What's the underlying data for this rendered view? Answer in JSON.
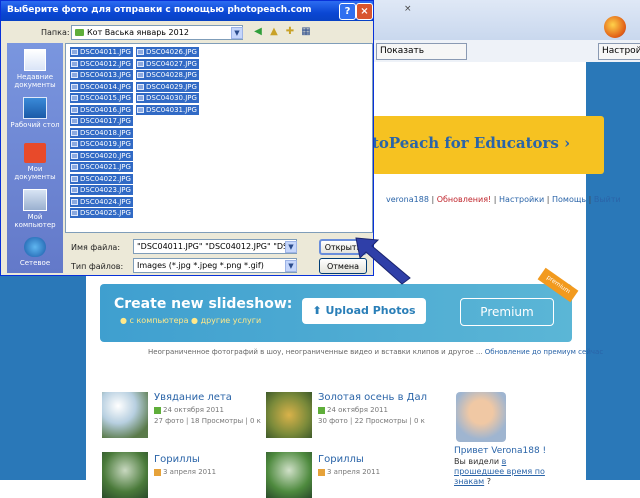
{
  "browser": {
    "close_glyph": "×",
    "show_original_label": "Показать оригинал",
    "settings_label": "Настройки"
  },
  "site": {
    "edu_banner": "toPeach for Educators ›",
    "user_bar": {
      "username": "verona188",
      "updates": "Обновления!",
      "settings": "Настройки",
      "help": "Помощь",
      "logout": "Выйти",
      "separator": " | "
    },
    "slideshow": {
      "title": "Create new slideshow:",
      "sub_from_computer": "с компьютера",
      "sub_other": "другие услуги",
      "upload_label": "Upload Photos",
      "premium_label": "Premium",
      "ribbon": "premium"
    },
    "promo": {
      "text": "Неограниченное фотографий в шоу, неограниченные видео и вставки клипов и другое ...",
      "link": "Обновление до премиум сейчас"
    },
    "albums": [
      {
        "title": "Увядание лета",
        "date": "24 октября 2011",
        "meta": "27 фото | 18 Просмотры | 0 к"
      },
      {
        "title": "Золотая осень в Дал",
        "date": "24 октября 2011",
        "meta": "30 фото | 22 Просмотры | 0 к"
      },
      {
        "title": "Гориллы",
        "date": "3 апреля 2011",
        "meta": ""
      },
      {
        "title": "Гориллы",
        "date": "3 апреля 2011",
        "meta": ""
      }
    ],
    "profile": {
      "greeting": "Привет Verona188 !",
      "text_prefix": "Вы видели",
      "text_link": "в прошедшее время по знакам",
      "text_suffix": "?"
    }
  },
  "dialog": {
    "title": "Выберите фото для отправки с помощью photopeach.com",
    "help_glyph": "?",
    "close_glyph": "×",
    "look_in_label": "Папка:",
    "look_in_value": "Кот Васька январь 2012",
    "toolbar_icons": [
      "back-icon",
      "up-folder-icon",
      "new-folder-icon",
      "view-menu-icon"
    ],
    "places": [
      {
        "label": "Недавние документы",
        "icon": "recent-documents-icon"
      },
      {
        "label": "Рабочий стол",
        "icon": "desktop-icon"
      },
      {
        "label": "Мои документы",
        "icon": "my-documents-icon"
      },
      {
        "label": "Мой компьютер",
        "icon": "my-computer-icon"
      },
      {
        "label": "Сетевое",
        "icon": "network-icon"
      }
    ],
    "files_col1": [
      "DSC04011.JPG",
      "DSC04012.JPG",
      "DSC04013.JPG",
      "DSC04014.JPG",
      "DSC04015.JPG",
      "DSC04016.JPG",
      "DSC04017.JPG",
      "DSC04018.JPG",
      "DSC04019.JPG",
      "DSC04020.JPG",
      "DSC04021.JPG",
      "DSC04022.JPG",
      "DSC04023.JPG",
      "DSC04024.JPG",
      "DSC04025.JPG"
    ],
    "files_col2": [
      "DSC04026.JPG",
      "DSC04027.JPG",
      "DSC04028.JPG",
      "DSC04029.JPG",
      "DSC04030.JPG",
      "DSC04031.JPG"
    ],
    "filename_label": "Имя файла:",
    "filename_value": "\"DSC04011.JPG\" \"DSC04012.JPG\" \"DSC04",
    "filetype_label": "Тип файлов:",
    "filetype_value": "Images (*.jpg *.jpeg *.png *.gif)",
    "open_label": "Открыть",
    "cancel_label": "Отмена"
  },
  "colors": {
    "dialog_title": "#0a46d3",
    "selection": "#316ac5",
    "page_frame": "#2a78b8",
    "edu_banner": "#f6c221",
    "slideshow_banner": "#3f9fcf",
    "arrow": "#2f3fa8"
  }
}
